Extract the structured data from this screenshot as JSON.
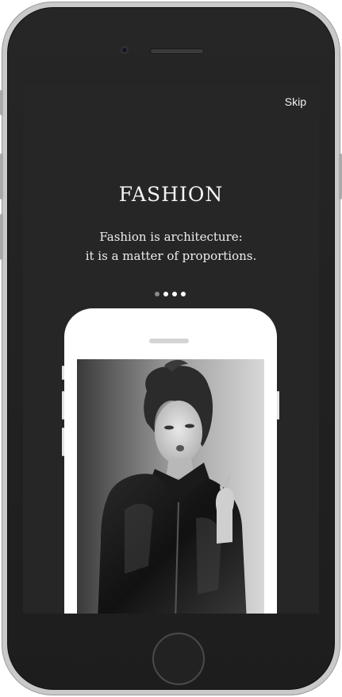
{
  "onboarding": {
    "skip_label": "Skip",
    "title": "FASHION",
    "subtitle_line1": "Fashion is architecture:",
    "subtitle_line2": "it is a matter of proportions.",
    "pagination": {
      "total": 4,
      "active_index": 0
    }
  },
  "colors": {
    "screen_background": "#262626",
    "text": "#f5f5f5",
    "dot_active": "#ffffff",
    "dot_inactive": "#8a8a8a"
  },
  "icons": {
    "home_button": "home-button",
    "front_camera": "camera-icon"
  }
}
